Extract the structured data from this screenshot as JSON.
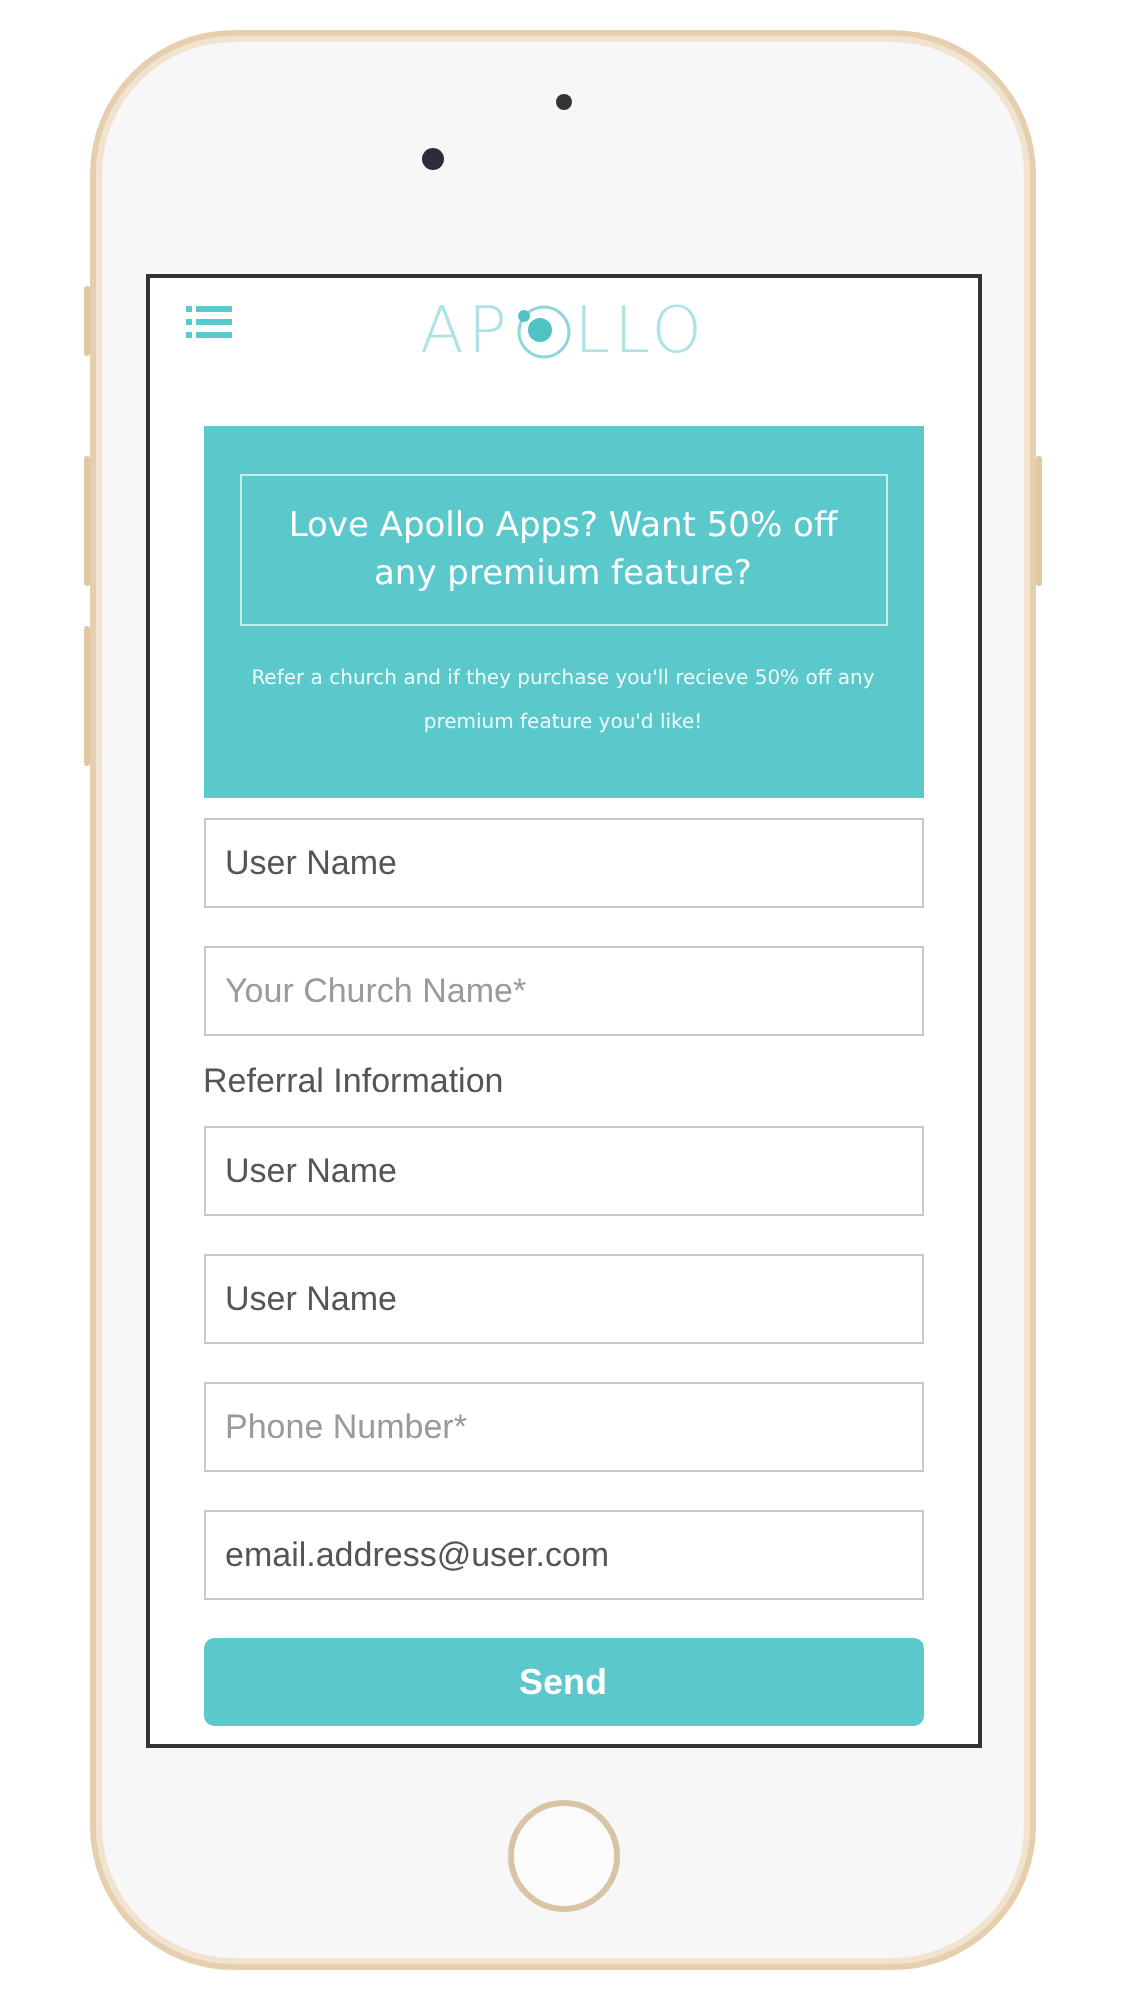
{
  "header": {
    "logo_start": "AP",
    "logo_end": "LLO"
  },
  "banner": {
    "title": "Love Apollo Apps? Want 50% off any premium feature?",
    "text": "Refer a church and if they purchase you'll recieve 50% off any premium feature you'd like!"
  },
  "fields": [
    {
      "value": "User Name"
    },
    {
      "placeholder": "Your Church Name*"
    }
  ],
  "section_label": "Referral Information",
  "referral_fields": [
    {
      "value": "User Name"
    },
    {
      "value": "User Name"
    },
    {
      "placeholder": "Phone Number*"
    },
    {
      "value": "email.address@user.com"
    }
  ],
  "send_button": "Send"
}
